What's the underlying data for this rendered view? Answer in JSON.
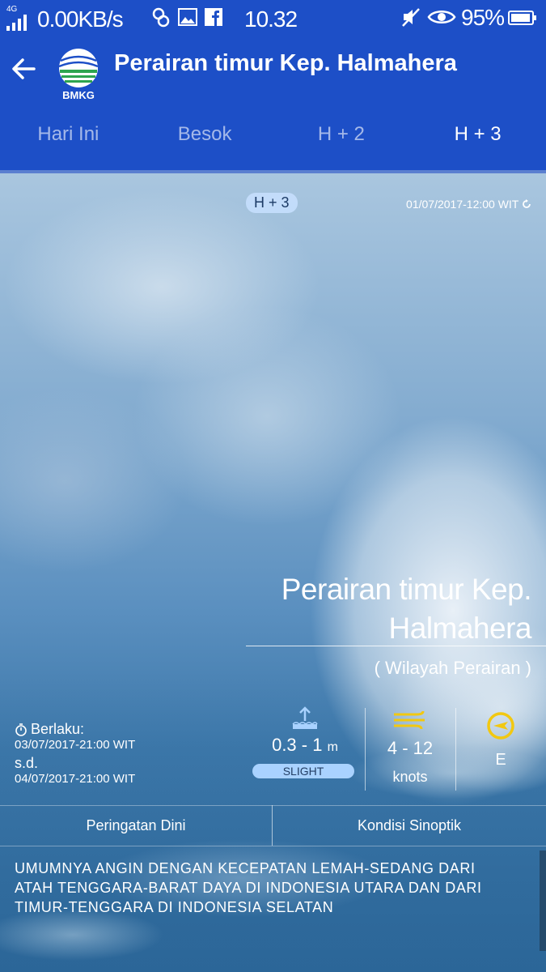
{
  "status_bar": {
    "network": "4G",
    "speed": "0.00KB/s",
    "time": "10.32",
    "battery": "95%",
    "battery_level": 0.95
  },
  "app_bar": {
    "title": "Perairan timur Kep. Halmahera",
    "logo_text": "BMKG"
  },
  "tabs": [
    {
      "label": "Hari Ini"
    },
    {
      "label": "Besok"
    },
    {
      "label": "H + 2"
    },
    {
      "label": "H + 3"
    }
  ],
  "forecast": {
    "badge": "H + 3",
    "issued": "01/07/2017-12:00 WIT",
    "region_name": "Perairan timur Kep. Halmahera",
    "region_type": "( Wilayah Perairan )",
    "valid_label": "Berlaku:",
    "valid_from": "03/07/2017-21:00 WIT",
    "valid_sd": "s.d.",
    "valid_to": "04/07/2017-21:00 WIT",
    "wave": {
      "value": "0.3 - 1",
      "unit": "m",
      "category": "SLIGHT"
    },
    "wind": {
      "value": "4 - 12",
      "unit": "knots"
    },
    "direction": {
      "value": "E"
    }
  },
  "sub_tabs": [
    {
      "label": "Peringatan Dini"
    },
    {
      "label": "Kondisi Sinoptik"
    }
  ],
  "warning_text": "UMUMNYA ANGIN DENGAN KECEPATAN LEMAH-SEDANG DARI ATAH TENGGARA-BARAT DAYA DI INDONESIA UTARA DAN DARI TIMUR-TENGGARA DI INDONESIA SELATAN",
  "colors": {
    "primary": "#1d4fc7",
    "accent": "#f2c811",
    "badge": "#a9d2ff"
  },
  "icons": [
    "signal-icon",
    "social-app-icon",
    "gallery-icon",
    "facebook-icon",
    "mute-icon",
    "eye-icon",
    "battery-icon",
    "back-arrow-icon",
    "bmkg-logo",
    "clock-icon",
    "wave-height-icon",
    "wind-icon",
    "direction-icon",
    "refresh-icon"
  ]
}
